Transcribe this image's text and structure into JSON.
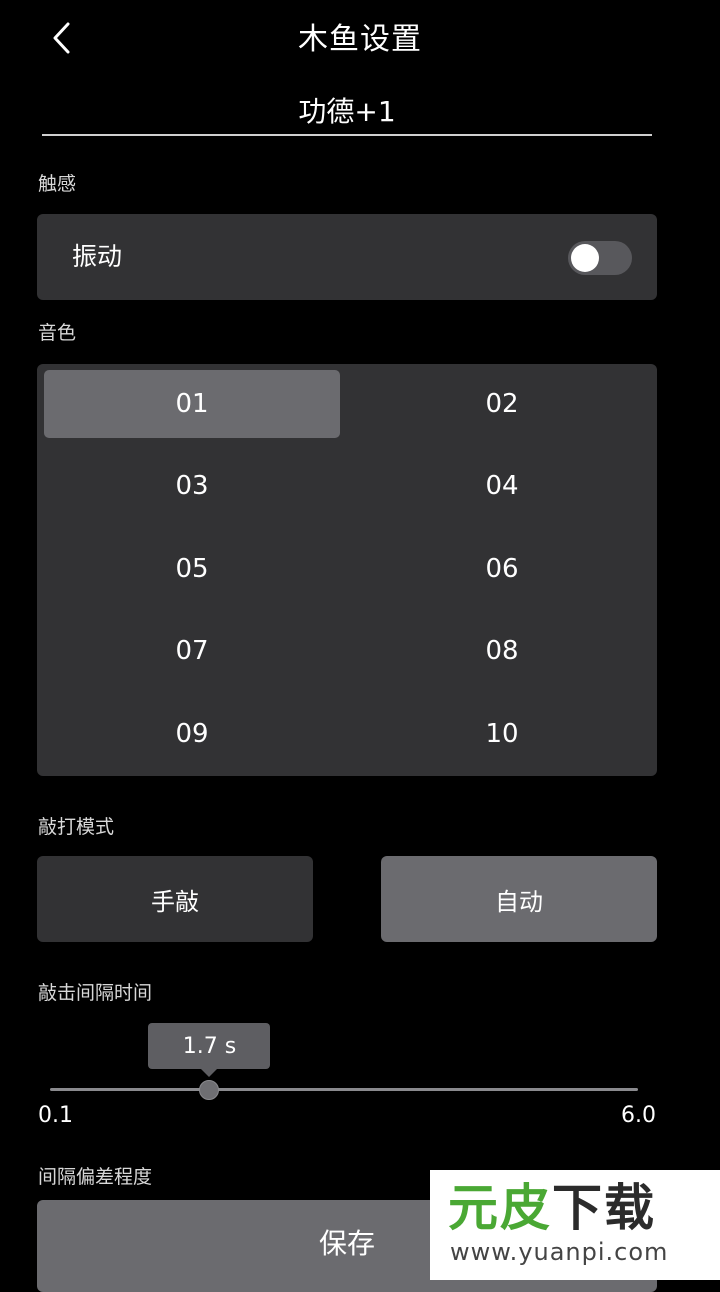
{
  "header": {
    "title": "木鱼设置",
    "back_icon": "chevron-left-icon"
  },
  "name_field": {
    "value": "功德+1"
  },
  "haptics": {
    "section_label": "触感",
    "vibration_label": "振动",
    "vibration_enabled": false
  },
  "tone": {
    "section_label": "音色",
    "options": [
      "01",
      "02",
      "03",
      "04",
      "05",
      "06",
      "07",
      "08",
      "09",
      "10"
    ],
    "selected": "01"
  },
  "tap_mode": {
    "section_label": "敲打模式",
    "manual_label": "手敲",
    "auto_label": "自动",
    "selected": "自动"
  },
  "interval": {
    "section_label": "敲击间隔时间",
    "value": 1.7,
    "value_label": "1.7 s",
    "min": 0.1,
    "max": 6.0,
    "min_label": "0.1",
    "max_label": "6.0"
  },
  "partial_section_label": "间隔偏差程度",
  "save_label": "保存",
  "watermark": {
    "logo_part1": "元皮",
    "logo_part2": "下载",
    "url": "www.yuanpi.com"
  },
  "colors": {
    "background": "#000000",
    "panel": "#323234",
    "selected": "#6b6b6f",
    "watermark_green": "#4aa834"
  }
}
